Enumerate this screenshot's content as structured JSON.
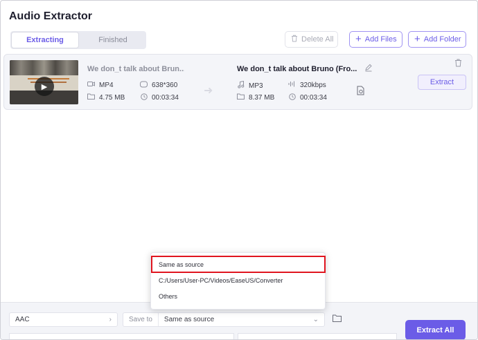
{
  "app": {
    "title": "Audio Extractor"
  },
  "tabs": [
    {
      "label": "Extracting",
      "active": true
    },
    {
      "label": "Finished",
      "active": false
    }
  ],
  "toolbar": {
    "delete_all": "Delete All",
    "add_files": "Add Files",
    "add_folder": "Add Folder"
  },
  "file": {
    "source": {
      "name": "We don_t talk about Bruno (From Encanto)",
      "format": "MP4",
      "resolution": "638*360",
      "size": "4.75 MB",
      "duration": "00:03:34"
    },
    "output": {
      "name": "We don_t talk about Bruno (From Encanto)",
      "format": "MP3",
      "bitrate": "320kbps",
      "size": "8.37 MB",
      "duration": "00:03:34"
    },
    "extract_label": "Extract"
  },
  "bottom": {
    "format_value": "AAC",
    "save_to_label": "Save to",
    "save_to_value": "Same as source",
    "extract_all_label": "Extract All"
  },
  "dropdown": {
    "options": [
      "Same as source",
      "C:/Users/User-PC/Videos/EaseUS/Converter",
      "Others"
    ],
    "selected": "Same as source"
  },
  "colors": {
    "accent": "#6b5ce7",
    "highlight_border": "#e0141e"
  }
}
